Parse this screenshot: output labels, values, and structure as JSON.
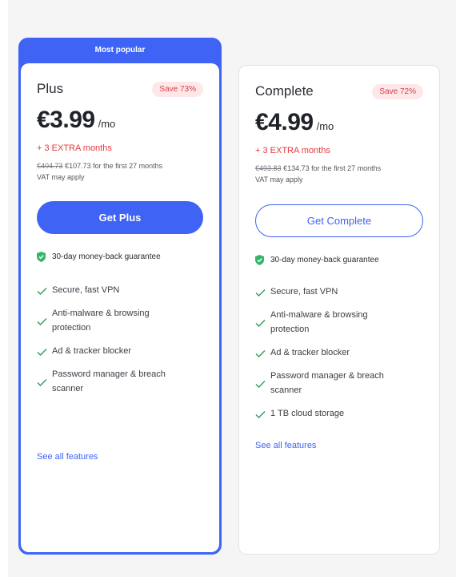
{
  "plus": {
    "badge": "Most popular",
    "name": "Plus",
    "save": "Save 73%",
    "price": "€3.99",
    "per": "/mo",
    "extra": "+ 3 EXTRA months",
    "old_price": "€404.73",
    "new_price": "€107.73",
    "billing_suffix": "for the first 27 months",
    "vat": "VAT may apply",
    "cta": "Get Plus",
    "guarantee": "30-day money-back guarantee",
    "features": [
      "Secure, fast VPN",
      "Anti-malware & browsing protection",
      "Ad & tracker blocker",
      "Password manager & breach scanner"
    ],
    "see_all": "See all features"
  },
  "complete": {
    "name": "Complete",
    "save": "Save 72%",
    "price": "€4.99",
    "per": "/mo",
    "extra": "+ 3 EXTRA months",
    "old_price": "€493.83",
    "new_price": "€134.73",
    "billing_suffix": "for the first 27 months",
    "vat": "VAT may apply",
    "cta": "Get Complete",
    "guarantee": "30-day money-back guarantee",
    "features": [
      "Secure, fast VPN",
      "Anti-malware & browsing protection",
      "Ad & tracker blocker",
      "Password manager & breach scanner",
      "1 TB cloud storage"
    ],
    "see_all": "See all features"
  },
  "colors": {
    "accent": "#3e63f5",
    "extra_red": "#e5383f",
    "save_bg": "#fde7e8",
    "check_green": "#2e9b5b",
    "shield_green": "#35b56a"
  },
  "icons": {
    "guarantee": "shield-check-icon",
    "feature": "check-icon"
  }
}
